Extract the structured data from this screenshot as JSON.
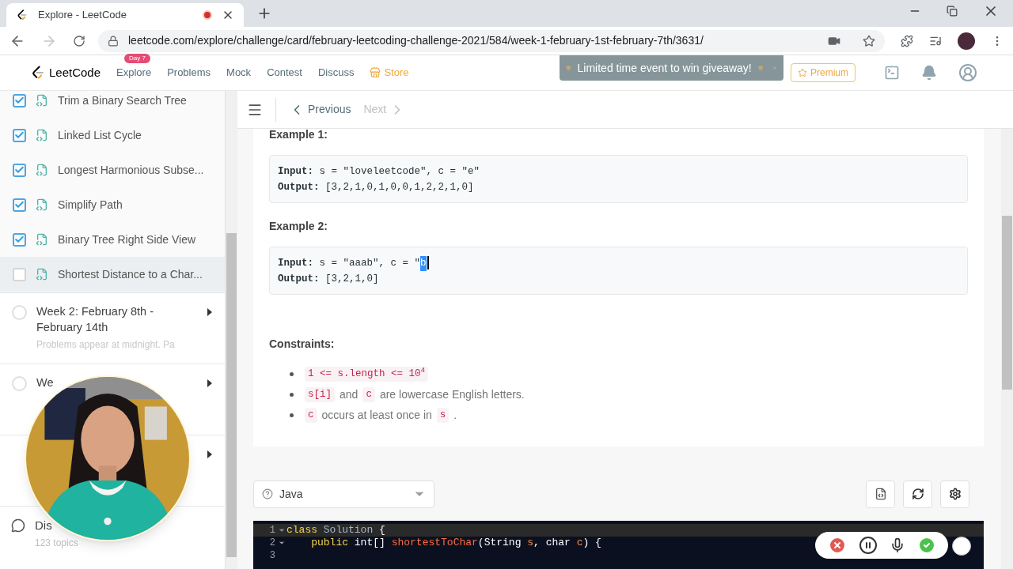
{
  "browser": {
    "tab_title": "Explore - LeetCode",
    "recording": true,
    "url": "leetcode.com/explore/challenge/card/february-leetcoding-challenge-2021/584/week-1-february-1st-february-7th/3631/"
  },
  "nav": {
    "brand": "LeetCode",
    "items": [
      {
        "label": "Explore",
        "badge": "Day 7",
        "kind": "link"
      },
      {
        "label": "Problems",
        "kind": "link"
      },
      {
        "label": "Mock",
        "kind": "link"
      },
      {
        "label": "Contest",
        "kind": "link"
      },
      {
        "label": "Discuss",
        "kind": "link"
      },
      {
        "label": "Store",
        "kind": "store"
      }
    ],
    "banner": "Limited time event to win giveaway!",
    "premium": "Premium"
  },
  "sidebar": {
    "problems": [
      {
        "title": "Trim a Binary Search Tree",
        "checked": true,
        "selected": false
      },
      {
        "title": "Linked List Cycle",
        "checked": true,
        "selected": false
      },
      {
        "title": "Longest Harmonious Subse...",
        "checked": true,
        "selected": false
      },
      {
        "title": "Simplify Path",
        "checked": true,
        "selected": false
      },
      {
        "title": "Binary Tree Right Side View",
        "checked": true,
        "selected": false
      },
      {
        "title": "Shortest Distance to a Char...",
        "checked": false,
        "selected": true
      }
    ],
    "weeks": [
      {
        "title": "Week 2: February 8th - February 14th",
        "subtitle": "Problems appear at midnight. Pa",
        "expanded": false
      },
      {
        "title": "We",
        "expanded": false
      },
      {
        "expanded": false
      }
    ],
    "discuss": {
      "title": "Dis",
      "subtitle": "123 topics"
    }
  },
  "toolbar": {
    "previous": {
      "label": "Previous",
      "disabled": false
    },
    "next": {
      "label": "Next",
      "disabled": true
    }
  },
  "content": {
    "examples": [
      {
        "heading": "Example 1:",
        "lines": [
          "**Input:** s = \"loveleetcode\", c = \"e\"",
          "**Output:** [3,2,1,0,1,0,0,1,2,2,1,0]"
        ]
      },
      {
        "heading": "Example 2:",
        "lines": [
          "**Input:** s = \"aaab\", c = \"",
          "**Output:** [3,2,1,0]"
        ],
        "selection": "b"
      }
    ],
    "constraints_heading": "Constraints:",
    "constraints": [
      [
        {
          "kind": "code",
          "text": "1 <= s.length <= 10$^{4}$"
        }
      ],
      [
        {
          "kind": "code",
          "text": "s[i]"
        },
        {
          "kind": "text",
          "text": "and"
        },
        {
          "kind": "code",
          "text": "c"
        },
        {
          "kind": "text",
          "text": "are lowercase English letters."
        }
      ],
      [
        {
          "kind": "code",
          "text": "c"
        },
        {
          "kind": "text",
          "text": "occurs at least once in"
        },
        {
          "kind": "code",
          "text": "s"
        },
        {
          "kind": "text",
          "text": "."
        }
      ]
    ]
  },
  "editor": {
    "language": "Java",
    "lines": [
      {
        "number": "1",
        "foldable": true,
        "highlighted": true,
        "tokens": [
          {
            "kind": "keyword",
            "text": "class"
          },
          {
            "kind": "type",
            "text": " Solution"
          },
          {
            "kind": "plain",
            "text": " {"
          }
        ]
      },
      {
        "number": "2",
        "foldable": true,
        "highlighted": false,
        "tokens": [
          {
            "kind": "keyword",
            "text": "    public"
          },
          {
            "kind": "plain",
            "text": " int[] "
          },
          {
            "kind": "function",
            "text": "shortestToChar"
          },
          {
            "kind": "plain",
            "text": "(String "
          },
          {
            "kind": "param",
            "text": "s"
          },
          {
            "kind": "plain",
            "text": ", char "
          },
          {
            "kind": "param",
            "text": "c"
          },
          {
            "kind": "plain",
            "text": ") {"
          }
        ]
      },
      {
        "number": "3",
        "foldable": false,
        "highlighted": false
      }
    ]
  }
}
